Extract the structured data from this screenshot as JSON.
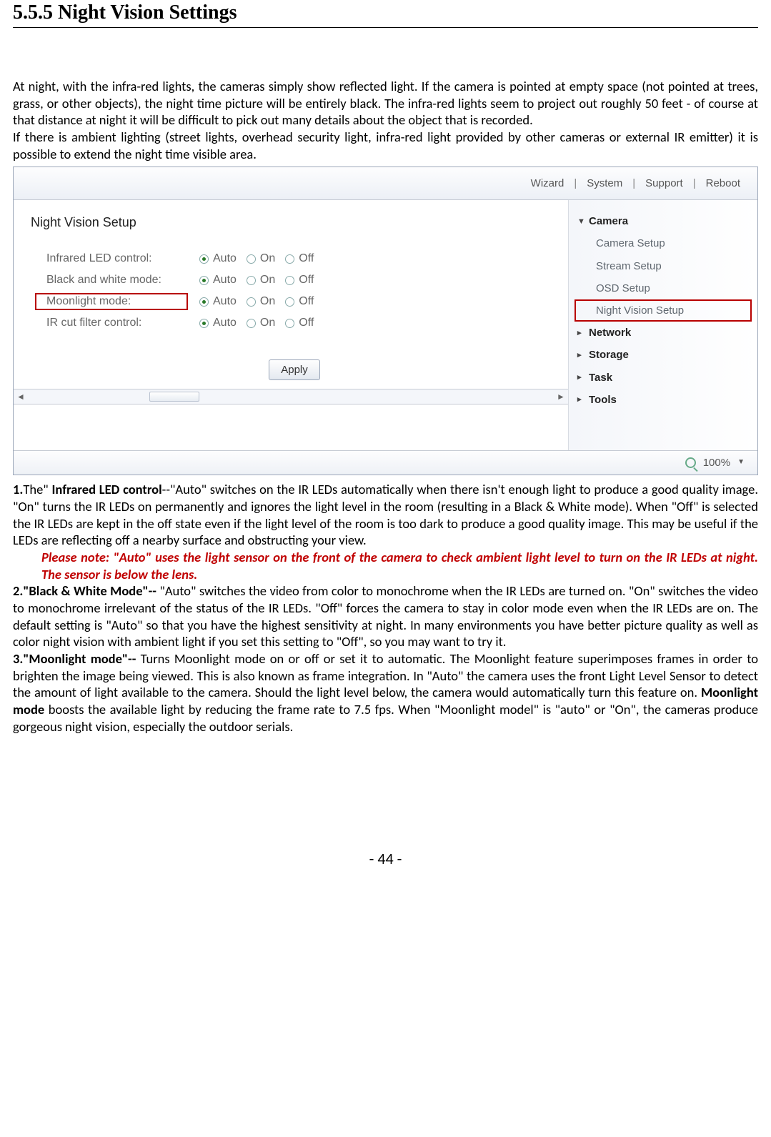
{
  "heading": "5.5.5 Night Vision Settings",
  "intro1": "At night, with the infra-red lights, the cameras simply show reflected light. If the camera is pointed at empty space (not pointed at trees, grass, or other objects), the night time picture will be entirely black. The infra-red lights seem to project out roughly 50 feet - of course at that distance at night it will be difficult to pick out many details about the object that is recorded.",
  "intro2": "If there is ambient lighting (street lights, overhead security light, infra-red light provided by other cameras or external IR emitter) it is possible to extend the night time visible area.",
  "topNav": {
    "wizard": "Wizard",
    "system": "System",
    "support": "Support",
    "reboot": "Reboot"
  },
  "panel": {
    "title": "Night Vision Setup",
    "rows": [
      {
        "label": "Infrared LED control:"
      },
      {
        "label": "Black and white mode:"
      },
      {
        "label": "Moonlight mode:"
      },
      {
        "label": "IR cut filter control:"
      }
    ],
    "opts": {
      "auto": "Auto",
      "on": "On",
      "off": "Off"
    },
    "apply": "Apply"
  },
  "side": {
    "camera": "Camera",
    "items": [
      "Camera Setup",
      "Stream Setup",
      "OSD Setup",
      "Night Vision Setup"
    ],
    "groups": [
      "Network",
      "Storage",
      "Task",
      "Tools"
    ]
  },
  "zoom": "100%",
  "p1_lead": "1.",
  "p1_strong": "Infrared LED control",
  "p1_rest": "--\"Auto\" switches on the IR LEDs automatically when there isn't enough light to produce a good quality image. \"On\" turns the IR LEDs on permanently and ignores the light level in the room (resulting in a Black & White mode). When \"Off\" is selected the IR LEDs are kept in the off state even if the light level of the room is too dark to produce a good quality image. This may be useful if the LEDs are reflecting off a nearby surface and obstructing your view.",
  "note": "Please note: \"Auto\" uses the light sensor on the front of the camera to check ambient light level to turn on the IR LEDs at night. The sensor is below the lens.",
  "p2_lead": "2.\"Black & White Mode\"--",
  "p2_rest": " \"Auto\" switches the video from color to monochrome when the IR LEDs are turned on. \"On\" switches the video to monochrome irrelevant of the status of the IR LEDs. \"Off\" forces the camera to stay in color mode even when the IR LEDs are on. The default setting is \"Auto\" so that you have the highest sensitivity at night. In many environments you have better picture quality as well as color night vision with ambient light if you set this setting to \"Off\", so you may want to try it.",
  "p3_lead": "3.\"Moonlight mode\"--",
  "p3_mid1": " Turns Moonlight mode on or off or set it to automatic. The Moonlight feature superimposes frames in order to brighten the image being viewed. This is also known as frame integration. In \"Auto\" the camera uses the front Light Level Sensor to detect the amount of light available to the camera. Should the light level below, the camera would automatically turn this feature on. ",
  "p3_strong": "Moonlight mode",
  "p3_mid2": " boosts the available light by reducing the frame rate to 7.5 fps. When \"Moonlight model\" is \"auto\" or \"On\", the cameras produce gorgeous night vision, especially the outdoor serials.",
  "pagenum": "- 44 -"
}
